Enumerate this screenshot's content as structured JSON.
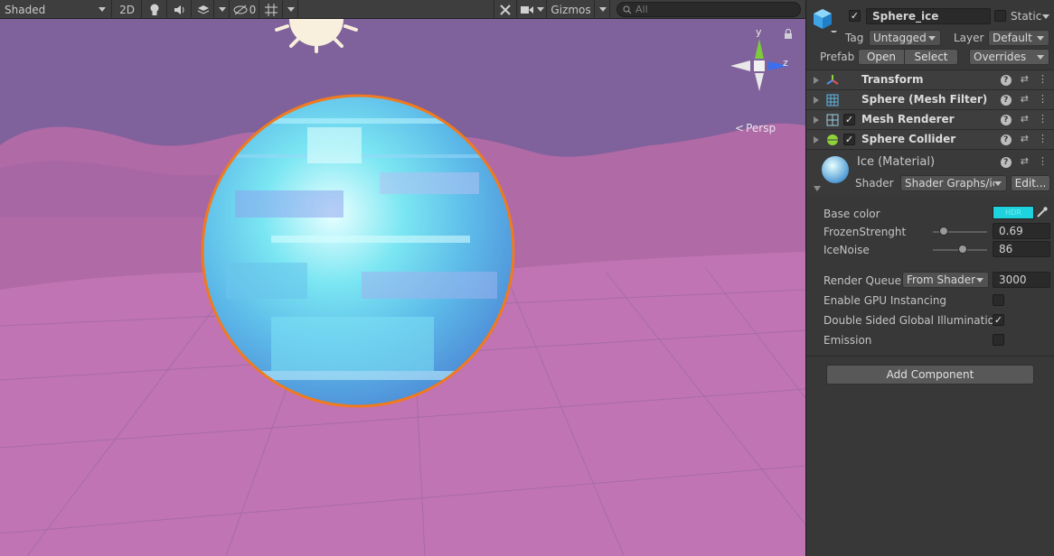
{
  "scene_toolbar": {
    "shading_mode": "Shaded",
    "mode_2d": "2D",
    "hidden_count": "0",
    "gizmos_label": "Gizmos",
    "search_placeholder": "All"
  },
  "viewport": {
    "projection_label": "Persp",
    "axis_y": "y",
    "axis_z": "z",
    "sky_color": "#7f619b",
    "cloud_color": "#b06aa6",
    "ground_color": "#c174b3",
    "selection_outline_color": "#f07a1e"
  },
  "inspector": {
    "object_name": "Sphere_ice",
    "static_label": "Static",
    "tag_label": "Tag",
    "tag_value": "Untagged",
    "layer_label": "Layer",
    "layer_value": "Default",
    "prefab_label": "Prefab",
    "prefab_open": "Open",
    "prefab_select": "Select",
    "prefab_overrides": "Overrides",
    "components": [
      {
        "title": "Transform"
      },
      {
        "title": "Sphere (Mesh Filter)"
      },
      {
        "title": "Mesh Renderer"
      },
      {
        "title": "Sphere Collider"
      }
    ],
    "material": {
      "name": "Ice (Material)",
      "shader_label": "Shader",
      "shader_value": "Shader Graphs/ice",
      "edit_button": "Edit...",
      "properties": {
        "base_color_label": "Base color",
        "base_color_value": "#1fd3de",
        "hdr_label": "HDR",
        "frozen_label": "FrozenStrenght",
        "frozen_value": "0.69",
        "frozen_fraction": 0.2,
        "noise_label": "IceNoise",
        "noise_value": "86",
        "noise_fraction": 0.55,
        "render_queue_label": "Render Queue",
        "render_queue_mode": "From Shader",
        "render_queue_value": "3000",
        "gpu_instancing_label": "Enable GPU Instancing",
        "double_sided_gi_label": "Double Sided Global Illumination",
        "emission_label": "Emission"
      }
    },
    "add_component": "Add Component"
  }
}
